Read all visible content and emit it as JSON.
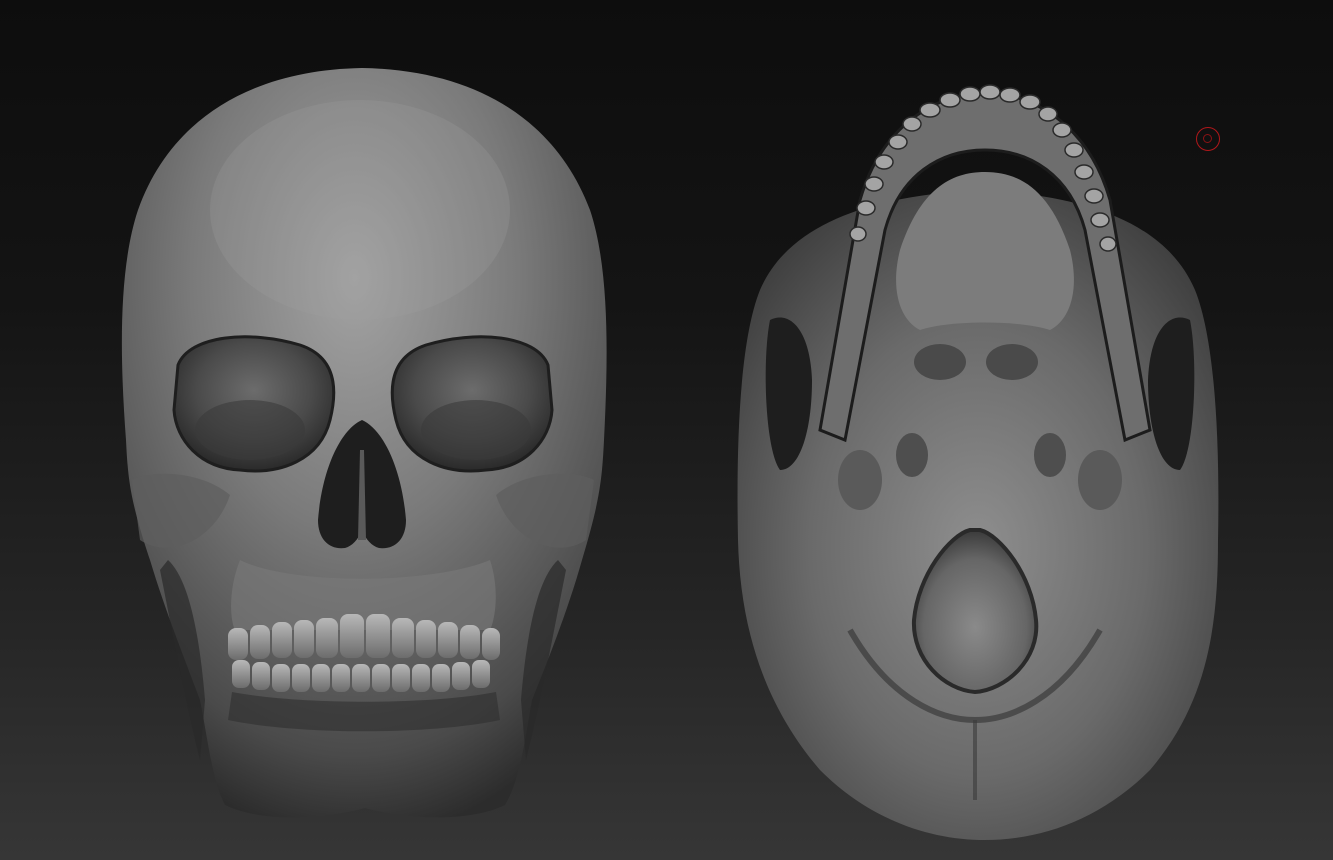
{
  "viewport": {
    "background_top": "#0d0d0d",
    "background_bottom": "#363636"
  },
  "models": {
    "material_light": "#9a9a9a",
    "material_mid": "#5a5a5a",
    "material_dark": "#1c1c1c",
    "front_view_subject": "skull-front",
    "bottom_view_subject": "skull-base"
  },
  "cursor": {
    "icon": "brush-cursor-icon",
    "color": "#b0171a"
  }
}
